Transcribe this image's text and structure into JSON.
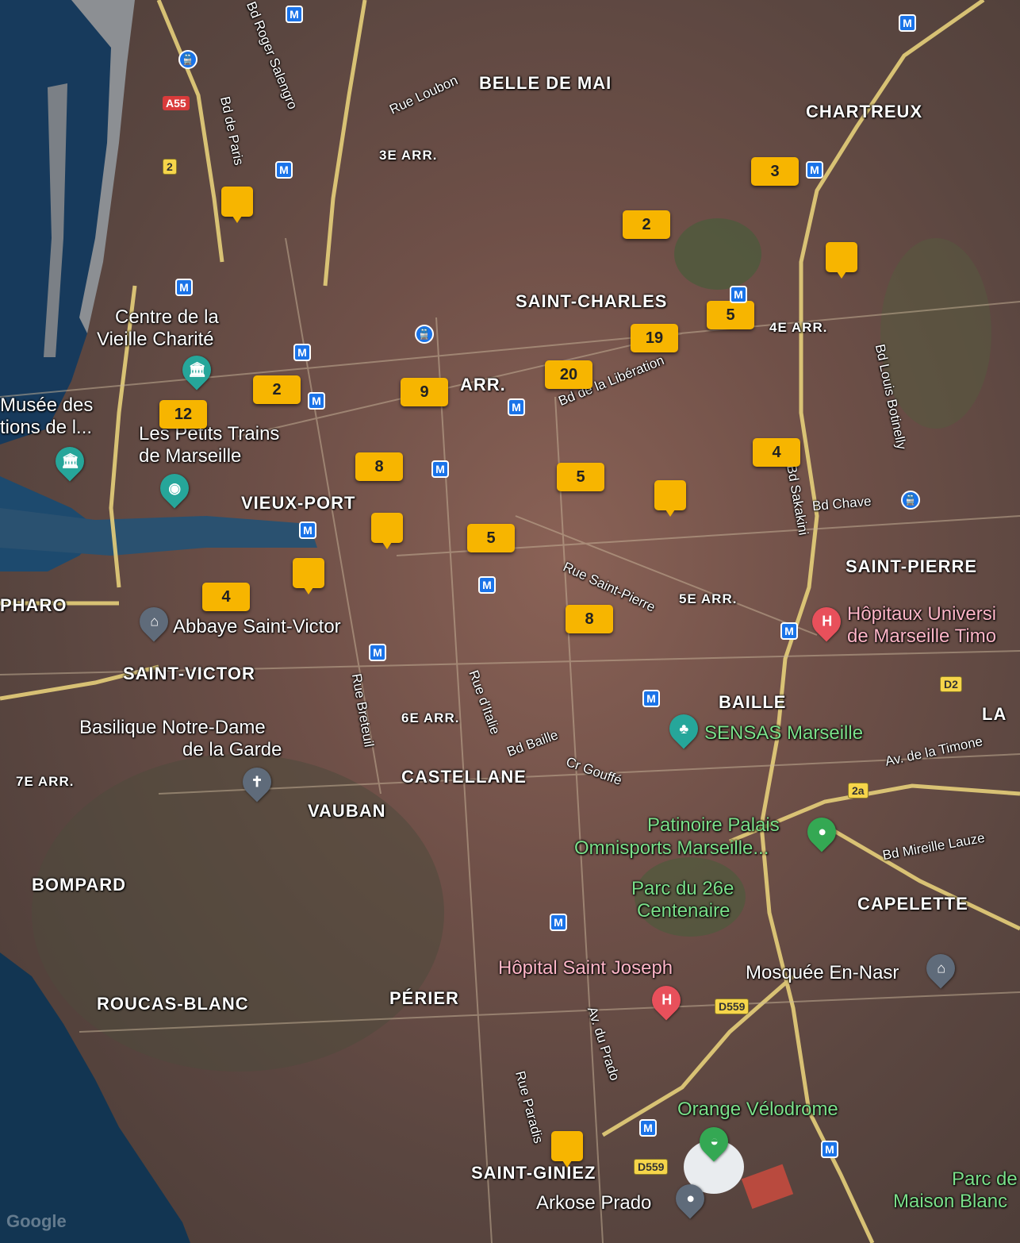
{
  "districts": [
    {
      "text": "BELLE DE MAI"
    },
    {
      "text": "CHARTREUX"
    },
    {
      "text": "SAINT-CHARLES"
    },
    {
      "text": "VIEUX-PORT"
    },
    {
      "text": "SAINT-PIERRE"
    },
    {
      "text": "PHARO"
    },
    {
      "text": "SAINT-VICTOR"
    },
    {
      "text": "BAILLE"
    },
    {
      "text": "CASTELLANE"
    },
    {
      "text": "VAUBAN"
    },
    {
      "text": "BOMPARD"
    },
    {
      "text": "CAPELETTE"
    },
    {
      "text": "ROUCAS-BLANC"
    },
    {
      "text": "PÉRIER"
    },
    {
      "text": "SAINT-GINIEZ"
    },
    {
      "text": "LA"
    }
  ],
  "arrondissements": [
    "3E ARR.",
    "4E ARR.",
    "ARR.",
    "5E ARR.",
    "6E ARR.",
    "7E ARR."
  ],
  "streets": [
    "Bd Roger Salengro",
    "Bd de Paris",
    "Rue Loubon",
    "Bd de la Libération",
    "Bd Louis Botinelly",
    "Bd Chave",
    "Bd Sakakini",
    "Rue Saint-Pierre",
    "Rue Breteuil",
    "Rue d'Italie",
    "Bd Baille",
    "Cr Gouffé",
    "Av. de la Timone",
    "Bd Mireille Lauze",
    "Av. du Prado",
    "Rue Paradis"
  ],
  "pois": [
    {
      "text": "Centre de la",
      "text2": "Vieille Charité",
      "icon": "museum-icon",
      "color": "#26a69a"
    },
    {
      "text": "Musée des",
      "text2": "tions de l...",
      "icon": "museum-icon",
      "color": "#26a69a"
    },
    {
      "text": "Les Petits Trains",
      "text2": "de Marseille",
      "icon": "camera-icon",
      "color": "#26a69a"
    },
    {
      "text": "Abbaye Saint-Victor",
      "text2": "",
      "icon": "church-icon",
      "color": "#5f6b7a"
    },
    {
      "text": "Basilique Notre-Dame",
      "text2": "de la Garde",
      "icon": "cross-icon",
      "color": "#5f6b7a"
    },
    {
      "text": "Hôpitaux Universi",
      "text2": "de Marseille Timo",
      "icon": "hospital-icon",
      "color": "#e8505b"
    },
    {
      "text": "SENSAS Marseille",
      "text2": "",
      "icon": "tree-icon",
      "color": "#26a69a"
    },
    {
      "text": "Patinoire Palais",
      "text2": "Omnisports Marseille...",
      "icon": "pin-icon",
      "color": "#34a853"
    },
    {
      "text": "Parc du 26e",
      "text2": "Centenaire",
      "icon": "",
      "color": ""
    },
    {
      "text": "Hôpital Saint Joseph",
      "text2": "",
      "icon": "hospital-icon",
      "color": "#e8505b"
    },
    {
      "text": "Mosquée En-Nasr",
      "text2": "",
      "icon": "mosque-icon",
      "color": "#5f6b7a"
    },
    {
      "text": "Orange Vélodrome",
      "text2": "",
      "icon": "stadium-icon",
      "color": "#34a853"
    },
    {
      "text": "Arkose Prado",
      "text2": "",
      "icon": "pin-icon",
      "color": "#5f6b7a"
    },
    {
      "text": "Parc de",
      "text2": "Maison Blanc",
      "icon": "",
      "color": ""
    }
  ],
  "clusters": [
    "3",
    "2",
    "5",
    "19",
    "20",
    "9",
    "2",
    "12",
    "8",
    "5",
    "4",
    "5",
    "4",
    "8"
  ],
  "shields": [
    "A55",
    "2",
    "D2",
    "2a",
    "D559",
    "D559"
  ],
  "metro_glyph": "M",
  "rail_glyph": "🚆",
  "watermark": "Google"
}
